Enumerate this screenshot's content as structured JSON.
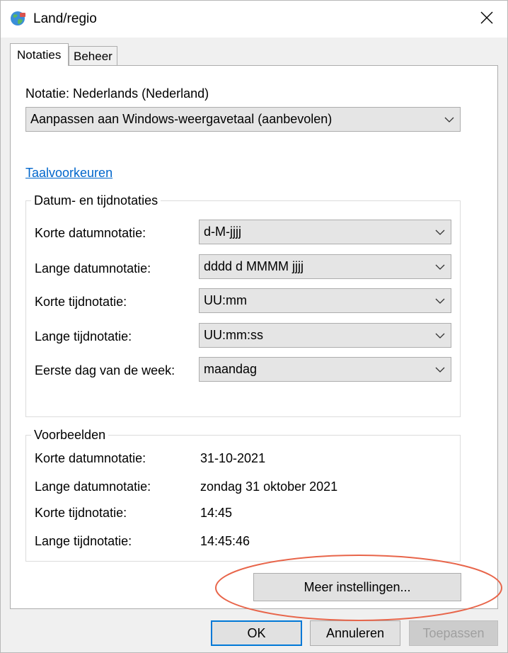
{
  "window": {
    "title": "Land/regio",
    "icon": "globe-icon",
    "close_icon": "close-icon"
  },
  "tabs": [
    {
      "label": "Notaties",
      "active": true
    },
    {
      "label": "Beheer",
      "active": false
    }
  ],
  "notation": {
    "label": "Notatie: Nederlands (Nederland)",
    "selected": "Aanpassen aan Windows-weergavetaal (aanbevolen)"
  },
  "language_link": "Taalvoorkeuren",
  "formats": {
    "group_title": "Datum- en tijdnotaties",
    "rows": [
      {
        "label": "Korte datumnotatie:",
        "value": "d-M-jjjj"
      },
      {
        "label": "Lange datumnotatie:",
        "value": "dddd d MMMM jjjj"
      },
      {
        "label": "Korte tijdnotatie:",
        "value": "UU:mm"
      },
      {
        "label": "Lange tijdnotatie:",
        "value": "UU:mm:ss"
      },
      {
        "label": "Eerste dag van de week:",
        "value": "maandag"
      }
    ]
  },
  "examples": {
    "group_title": "Voorbeelden",
    "rows": [
      {
        "label": "Korte datumnotatie:",
        "value": "31-10-2021"
      },
      {
        "label": "Lange datumnotatie:",
        "value": "zondag 31 oktober 2021"
      },
      {
        "label": "Korte tijdnotatie:",
        "value": "14:45"
      },
      {
        "label": "Lange tijdnotatie:",
        "value": "14:45:46"
      }
    ]
  },
  "more_settings_label": "Meer instellingen...",
  "buttons": {
    "ok": "OK",
    "cancel": "Annuleren",
    "apply": "Toepassen",
    "apply_enabled": false
  },
  "colors": {
    "link": "#0066cc",
    "focus_border": "#0078d7",
    "annotation": "#e8654a"
  }
}
